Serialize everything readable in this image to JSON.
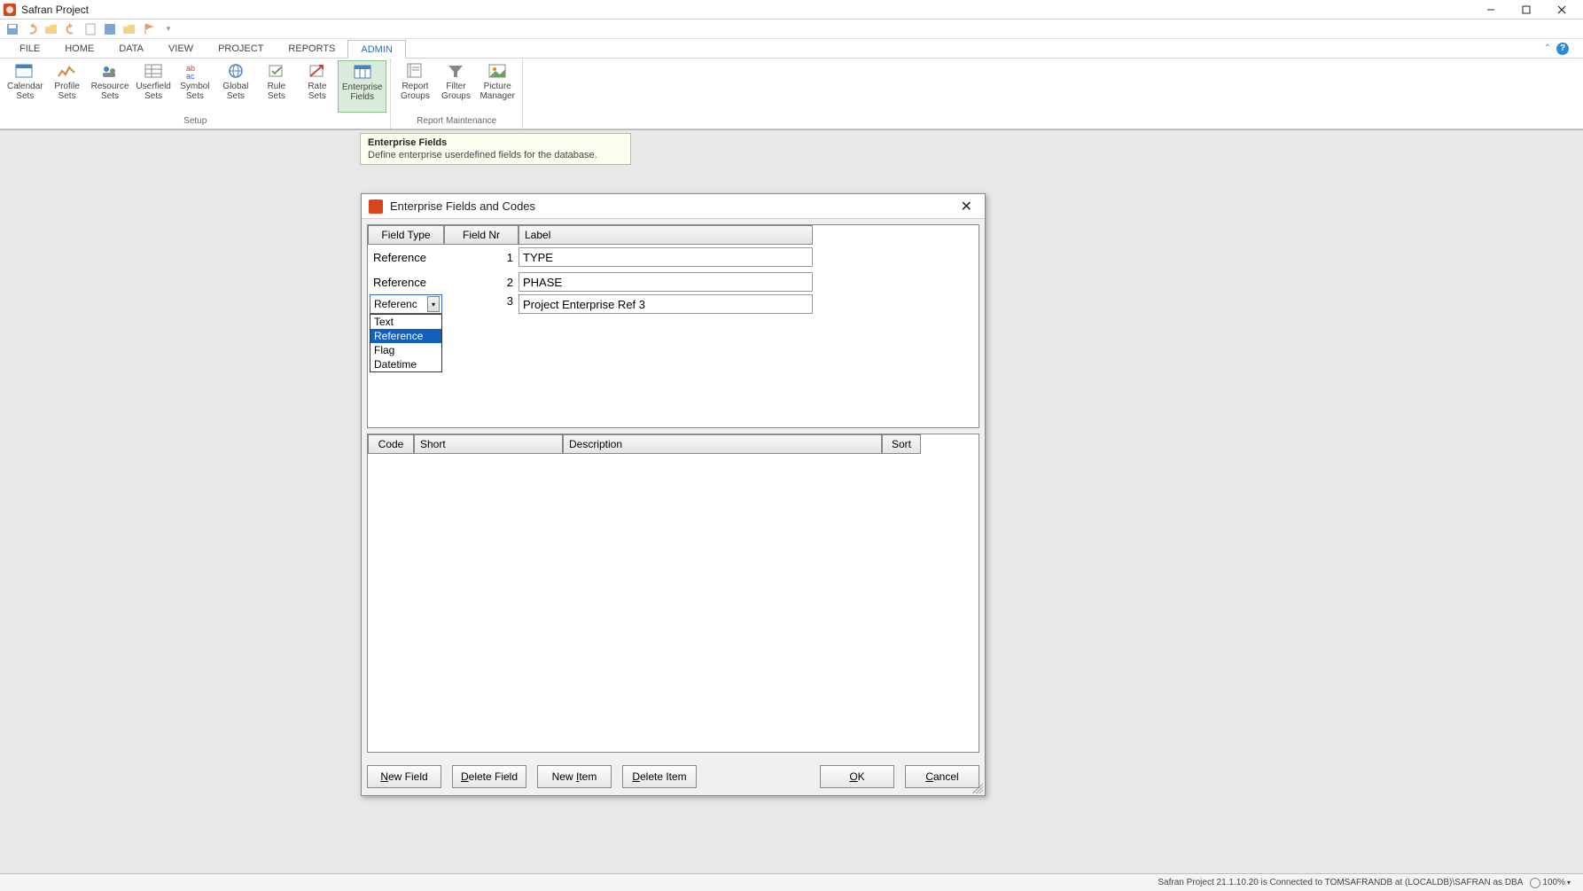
{
  "app": {
    "title": "Safran Project",
    "icon_name": "safran-logo-icon"
  },
  "window_controls": {
    "minimize": "minimize-icon",
    "maximize": "restore-icon",
    "close": "close-icon"
  },
  "menu": {
    "tabs": [
      "FILE",
      "HOME",
      "DATA",
      "VIEW",
      "PROJECT",
      "REPORTS",
      "ADMIN"
    ],
    "active": "ADMIN"
  },
  "ribbon": {
    "groups": [
      {
        "label": "Setup",
        "items": [
          {
            "label": "Calendar Sets",
            "icon": "calendar-icon"
          },
          {
            "label": "Profile Sets",
            "icon": "profile-icon"
          },
          {
            "label": "Resource Sets",
            "icon": "resource-icon"
          },
          {
            "label": "Userfield Sets",
            "icon": "userfield-icon"
          },
          {
            "label": "Symbol Sets",
            "icon": "symbol-icon"
          },
          {
            "label": "Global Sets",
            "icon": "global-icon"
          },
          {
            "label": "Rule Sets",
            "icon": "rule-icon"
          },
          {
            "label": "Rate Sets",
            "icon": "rate-icon"
          },
          {
            "label": "Enterprise Fields",
            "icon": "enterprise-fields-icon",
            "active": true
          }
        ]
      },
      {
        "label": "Report Maintenance",
        "items": [
          {
            "label": "Report Groups",
            "icon": "report-groups-icon"
          },
          {
            "label": "Filter Groups",
            "icon": "filter-groups-icon"
          },
          {
            "label": "Picture Manager",
            "icon": "picture-manager-icon"
          }
        ]
      }
    ]
  },
  "tooltip": {
    "title": "Enterprise Fields",
    "desc": "Define enterprise userdefined fields for the database."
  },
  "dialog": {
    "title": "Enterprise Fields and Codes",
    "top_grid": {
      "headers": {
        "field_type": "Field Type",
        "field_nr": "Field Nr",
        "label": "Label"
      },
      "rows": [
        {
          "field_type": "Reference",
          "field_nr": "1",
          "label": "TYPE"
        },
        {
          "field_type": "Reference",
          "field_nr": "2",
          "label": "PHASE"
        },
        {
          "field_type": "Referenc",
          "field_nr": "3",
          "label": "Project Enterprise Ref 3",
          "dropdown": true
        }
      ],
      "dropdown_options": [
        "Text",
        "Reference",
        "Flag",
        "Datetime"
      ],
      "dropdown_selected": "Reference"
    },
    "bottom_grid": {
      "headers": {
        "code": "Code",
        "short": "Short",
        "description": "Description",
        "sort": "Sort"
      }
    },
    "buttons": {
      "new_field": "New Field",
      "delete_field": "Delete Field",
      "new_item": "New Item",
      "delete_item": "Delete Item",
      "ok": "OK",
      "cancel": "Cancel"
    }
  },
  "statusbar": {
    "text": "Safran Project 21.1.10.20 is Connected to TOMSAFRANDB at (LOCALDB)\\SAFRAN as DBA",
    "zoom": "100%"
  }
}
